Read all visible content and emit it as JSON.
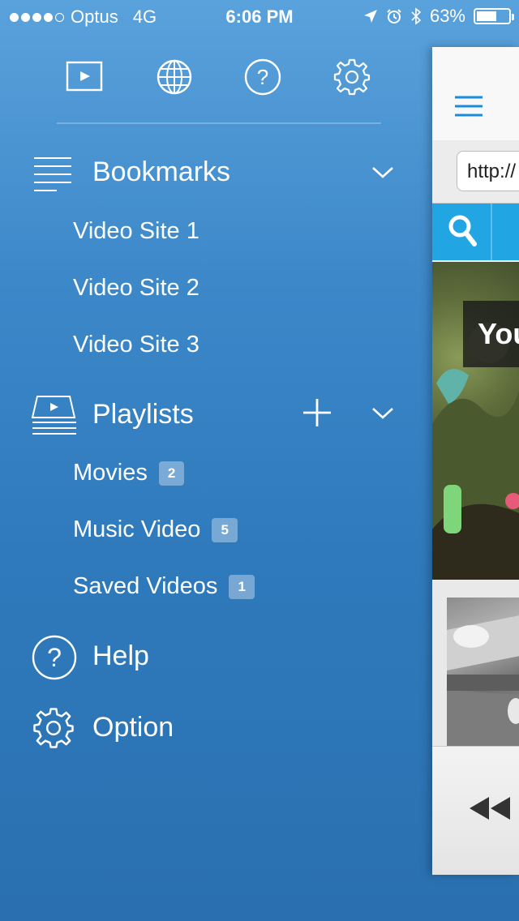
{
  "status_bar": {
    "carrier": "Optus",
    "network": "4G",
    "time": "6:06 PM",
    "battery": "63%",
    "battery_level": 0.63,
    "signal_bars_filled": 4,
    "signal_bars_total": 5
  },
  "toolbar": {
    "icons": [
      "video-player-icon",
      "globe-icon",
      "help-icon",
      "settings-icon"
    ]
  },
  "bookmarks": {
    "label": "Bookmarks",
    "items": [
      "Video Site 1",
      "Video Site 2",
      "Video Site 3"
    ]
  },
  "playlists": {
    "label": "Playlists",
    "items": [
      {
        "label": "Movies",
        "count": "2"
      },
      {
        "label": "Music Video",
        "count": "5"
      },
      {
        "label": "Saved Videos",
        "count": "1"
      }
    ]
  },
  "help": {
    "label": "Help"
  },
  "option": {
    "label": "Option"
  },
  "browser_peek": {
    "url_text": "http://",
    "video_title": "You"
  },
  "colors": {
    "accent_blue": "#22a6e3",
    "hamburger_blue": "#1a8ce0"
  }
}
